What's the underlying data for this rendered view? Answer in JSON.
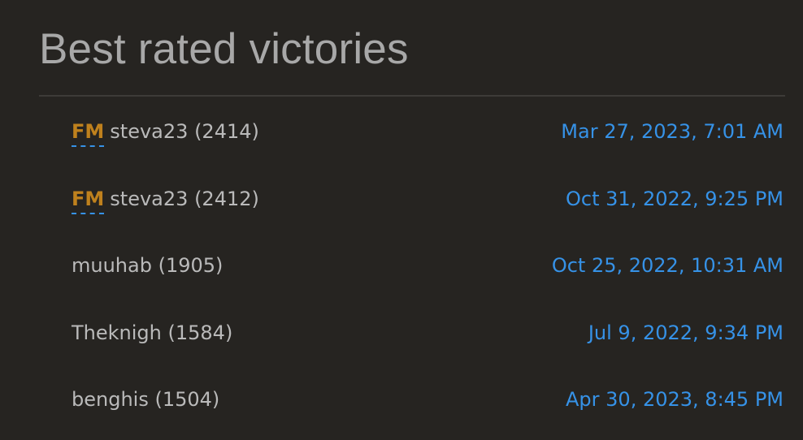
{
  "page": {
    "title": "Best rated victories"
  },
  "victories": [
    {
      "title": "FM",
      "username": "steva23",
      "rating": "(2414)",
      "date": "Mar 27, 2023, 7:01 AM"
    },
    {
      "title": "FM",
      "username": "steva23",
      "rating": "(2412)",
      "date": "Oct 31, 2022, 9:25 PM"
    },
    {
      "title": "",
      "username": "muuhab",
      "rating": "(1905)",
      "date": "Oct 25, 2022, 10:31 AM"
    },
    {
      "title": "",
      "username": "Theknigh",
      "rating": "(1584)",
      "date": "Jul 9, 2022, 9:34 PM"
    },
    {
      "title": "",
      "username": "benghis",
      "rating": "(1504)",
      "date": "Apr 30, 2023, 8:45 PM"
    }
  ],
  "colors": {
    "background": "#262421",
    "text": "#bababa",
    "title_badge": "#bf811d",
    "link": "#3692e7"
  }
}
